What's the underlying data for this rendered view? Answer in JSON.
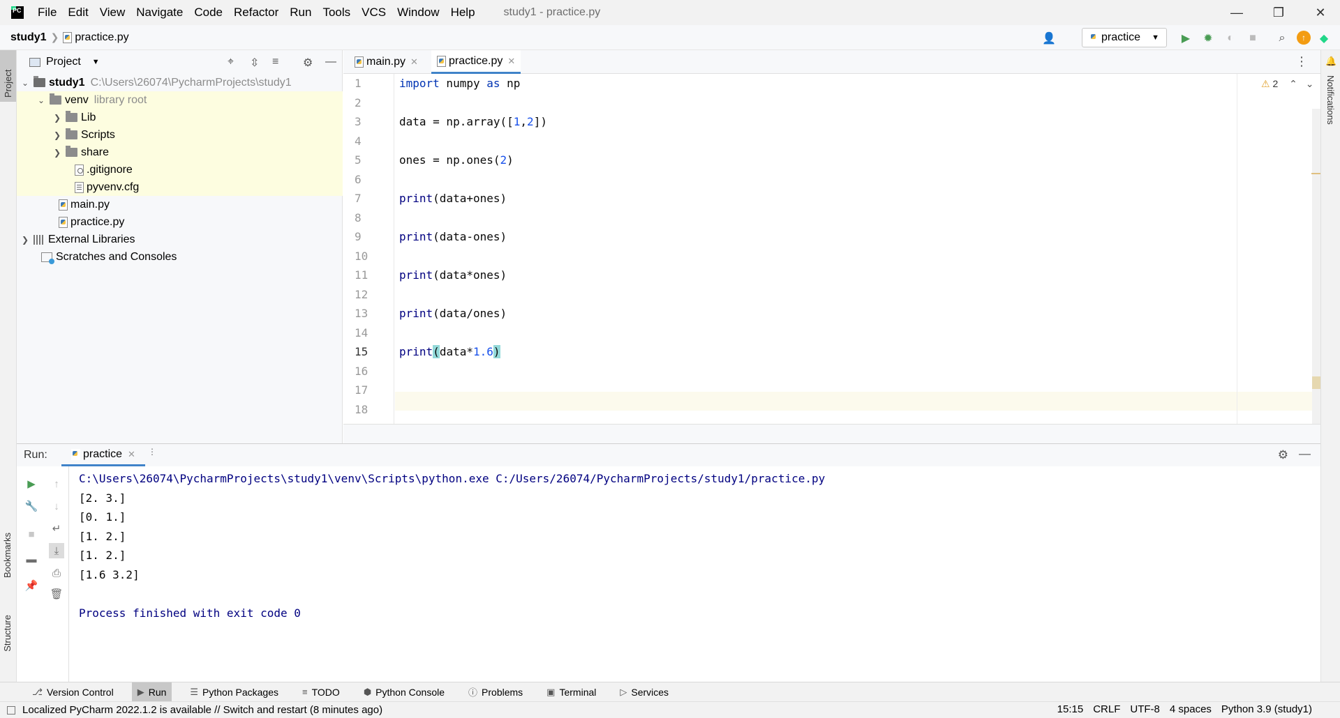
{
  "menubar": {
    "items": [
      "File",
      "Edit",
      "View",
      "Navigate",
      "Code",
      "Refactor",
      "Run",
      "Tools",
      "VCS",
      "Window",
      "Help"
    ],
    "window_title": "study1 - practice.py"
  },
  "navbar": {
    "project": "study1",
    "file": "practice.py",
    "run_config": "practice"
  },
  "left_strip": {
    "project_tab": "Project",
    "bookmarks_tab": "Bookmarks",
    "structure_tab": "Structure"
  },
  "right_strip": {
    "notifications_tab": "Notifications"
  },
  "project_panel": {
    "title": "Project",
    "tree": [
      {
        "label": "study1",
        "extra": "C:\\Users\\26074\\PycharmProjects\\study1"
      },
      {
        "label": "venv",
        "extra": "library root"
      },
      {
        "label": "Lib"
      },
      {
        "label": "Scripts"
      },
      {
        "label": "share"
      },
      {
        "label": ".gitignore"
      },
      {
        "label": "pyvenv.cfg"
      },
      {
        "label": "main.py"
      },
      {
        "label": "practice.py"
      },
      {
        "label": "External Libraries"
      },
      {
        "label": "Scratches and Consoles"
      }
    ]
  },
  "editor": {
    "tabs": [
      "main.py",
      "practice.py"
    ],
    "warnings": "2",
    "line_numbers": [
      "1",
      "2",
      "3",
      "4",
      "5",
      "6",
      "7",
      "8",
      "9",
      "10",
      "11",
      "12",
      "13",
      "14",
      "15",
      "16",
      "17",
      "18"
    ],
    "code": {
      "l1": {
        "kw1": "import",
        "mid": " numpy ",
        "kw2": "as",
        "end": " np"
      },
      "l3": {
        "a": "data = np.array([",
        "n1": "1",
        "c": ",",
        "n2": "2",
        "b": "])"
      },
      "l5": {
        "a": "ones = np.ones(",
        "n": "2",
        "b": ")"
      },
      "l7": {
        "fn": "print",
        "rest": "(data+ones)"
      },
      "l9": {
        "fn": "print",
        "rest": "(data-ones)"
      },
      "l11": {
        "fn": "print",
        "rest": "(data*ones)"
      },
      "l13": {
        "fn": "print",
        "rest": "(data/ones)"
      },
      "l15": {
        "fn": "print",
        "open": "(",
        "mid": "data*",
        "num": "1.6",
        "close": ")"
      }
    }
  },
  "run_panel": {
    "label": "Run:",
    "tab": "practice",
    "console": [
      "C:\\Users\\26074\\PycharmProjects\\study1\\venv\\Scripts\\python.exe C:/Users/26074/PycharmProjects/study1/practice.py",
      "[2. 3.]",
      "[0. 1.]",
      "[1. 2.]",
      "[1. 2.]",
      "[1.6 3.2]",
      "",
      "Process finished with exit code 0"
    ]
  },
  "bottom_tools": [
    "Version Control",
    "Run",
    "Python Packages",
    "TODO",
    "Python Console",
    "Problems",
    "Terminal",
    "Services"
  ],
  "statusbar": {
    "message": "Localized PyCharm 2022.1.2 is available // Switch and restart (8 minutes ago)",
    "position": "15:15",
    "line_sep": "CRLF",
    "encoding": "UTF-8",
    "indent": "4 spaces",
    "interpreter": "Python 3.9 (study1)"
  },
  "colors": {
    "accent": "#4083c9",
    "keyword": "#0033b3",
    "number": "#1750eb",
    "run_green": "#499c54",
    "tree_highlight": "#fdfde0"
  }
}
